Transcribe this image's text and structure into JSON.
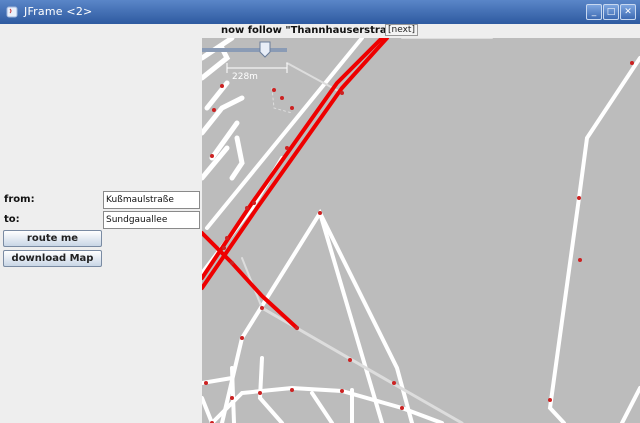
{
  "window": {
    "title": "JFrame <2>"
  },
  "form": {
    "from_label": "from:",
    "from_value": "Kußmaulstraße",
    "to_label": "to:",
    "to_value": "Sundgauallee",
    "route_button": "route me",
    "download_button": "download Map"
  },
  "navigation": {
    "instruction": "now follow \"Thannhauserstraße\"",
    "next_button": "[next]"
  },
  "map": {
    "scale_label": "228m",
    "colors": {
      "background": "#bcbcbc",
      "road": "#ffffff",
      "route": "#ee0000",
      "node": "#cc2222"
    }
  }
}
